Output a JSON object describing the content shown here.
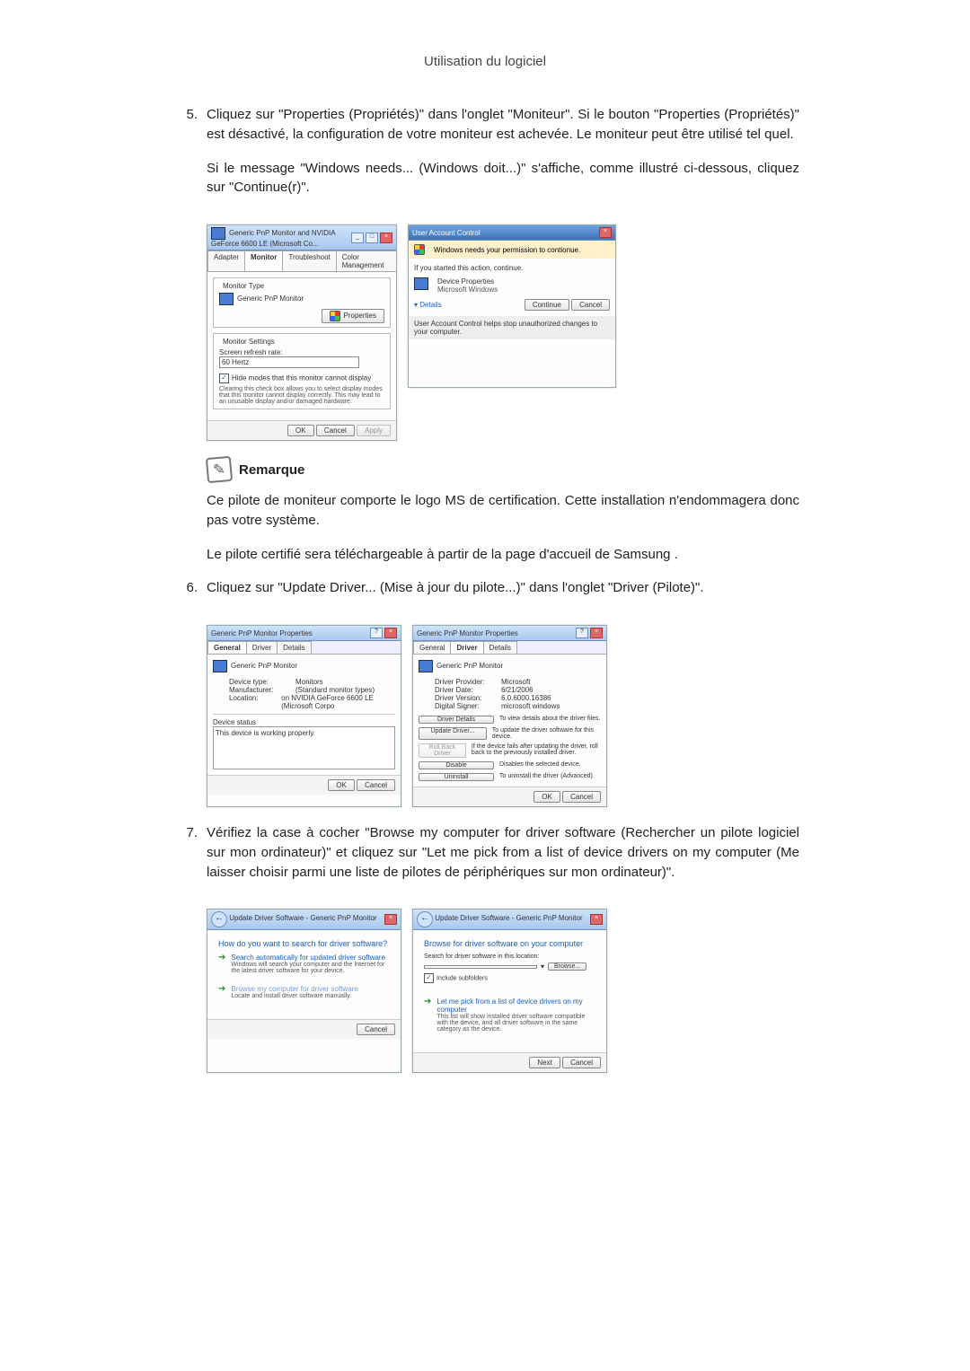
{
  "header": {
    "title": "Utilisation du logiciel"
  },
  "steps": {
    "s5": {
      "num": "5.",
      "p1": "Cliquez sur \"Properties (Propriétés)\" dans l'onglet \"Moniteur\". Si le bouton \"Properties (Propriétés)\" est désactivé, la configuration de votre moniteur est achevée. Le moniteur peut être utilisé tel quel.",
      "p2": "Si le message \"Windows needs... (Windows doit...)\" s'affiche, comme illustré ci-dessous, cliquez sur \"Continue(r)\"."
    },
    "s6": {
      "num": "6.",
      "p1": "Cliquez sur \"Update Driver... (Mise à jour du pilote...)\" dans l'onglet \"Driver (Pilote)\"."
    },
    "s7": {
      "num": "7.",
      "p1": "Vérifiez la case à cocher \"Browse my computer for driver software (Rechercher un pilote logiciel sur mon ordinateur)\" et cliquez sur \"Let me pick from a list of device drivers on my computer (Me laisser choisir parmi une liste de pilotes de périphériques sur mon ordinateur)\"."
    }
  },
  "note": {
    "title": "Remarque",
    "p1": "Ce pilote de moniteur comporte le logo MS de certification. Cette installation n'endommagera donc pas votre système.",
    "p2": "Le pilote certifié sera téléchargeable à partir de la page d'accueil de Samsung ."
  },
  "win_monitor": {
    "title": "Generic PnP Monitor and NVIDIA GeForce 6600 LE (Microsoft Co...",
    "tabs": {
      "adapter": "Adapter",
      "monitor": "Monitor",
      "troubleshoot": "Troubleshoot",
      "color": "Color Management"
    },
    "section_type": "Monitor Type",
    "monitor_name": "Generic PnP Monitor",
    "btn_properties": "Properties",
    "section_settings": "Monitor Settings",
    "refresh_label": "Screen refresh rate:",
    "refresh_value": "60 Hertz",
    "hide_modes": "Hide modes that this monitor cannot display",
    "hide_modes_desc": "Clearing this check box allows you to select display modes that this monitor cannot display correctly. This may lead to an unusable display and/or damaged hardware.",
    "ok": "OK",
    "cancel": "Cancel",
    "apply": "Apply"
  },
  "win_uac": {
    "title": "User Account Control",
    "band": "Windows needs your permission to contionue.",
    "if_started": "If you started this action, continue.",
    "prog_name": "Device Properties",
    "publisher": "Microsoft Windows",
    "details": "Details",
    "continue": "Continue",
    "cancel": "Cancel",
    "footer": "User Account Control helps stop unauthorized changes to your computer."
  },
  "win_gen": {
    "title": "Generic PnP Monitor Properties",
    "tabs": {
      "general": "General",
      "driver": "Driver",
      "details": "Details"
    },
    "name": "Generic PnP Monitor",
    "device_type_k": "Device type:",
    "device_type_v": "Monitors",
    "manufacturer_k": "Manufacturer:",
    "manufacturer_v": "(Standard monitor types)",
    "location_k": "Location:",
    "location_v": "on NVIDIA GeForce 6600 LE (Microsoft Corpo",
    "status_label": "Device status",
    "status_text": "This device is working properly.",
    "ok": "OK",
    "cancel": "Cancel"
  },
  "win_drv": {
    "title": "Generic PnP Monitor Properties",
    "tabs": {
      "general": "General",
      "driver": "Driver",
      "details": "Details"
    },
    "name": "Generic PnP Monitor",
    "provider_k": "Driver Provider:",
    "provider_v": "Microsoft",
    "date_k": "Driver Date:",
    "date_v": "6/21/2006",
    "version_k": "Driver Version:",
    "version_v": "6.0.6000.16386",
    "signer_k": "Digital Signer:",
    "signer_v": "microsoft windows",
    "btn_details": "Driver Details",
    "btn_details_d": "To view details about the driver files.",
    "btn_update": "Update Driver...",
    "btn_update_d": "To update the driver software for this device.",
    "btn_rollback": "Roll Back Driver",
    "btn_rollback_d": "If the device fails after updating the driver, roll back to the previously installed driver.",
    "btn_disable": "Disable",
    "btn_disable_d": "Disables the selected device.",
    "btn_uninstall": "Uninstall",
    "btn_uninstall_d": "To uninstall the driver (Advanced).",
    "ok": "OK",
    "cancel": "Cancel"
  },
  "win_wiz1": {
    "title": "Update Driver Software - Generic PnP Monitor",
    "heading": "How do you want to search for driver software?",
    "opt1_t": "Search automatically for updated driver software",
    "opt1_d": "Windows will search your computer and the Internet for the latest driver software for your device.",
    "opt2_t": "Browse my computer for driver software",
    "opt2_d": "Locate and install driver software manually.",
    "cancel": "Cancel"
  },
  "win_wiz2": {
    "title": "Update Driver Software - Generic PnP Monitor",
    "heading": "Browse for driver software on your computer",
    "search_label": "Search for driver software in this location:",
    "browse": "Browse...",
    "include_sub": "Include subfolders",
    "opt_t": "Let me pick from a list of device drivers on my computer",
    "opt_d": "This list will show installed driver software compatible with the device, and all driver software in the same category as the device.",
    "next": "Next",
    "cancel": "Cancel"
  }
}
